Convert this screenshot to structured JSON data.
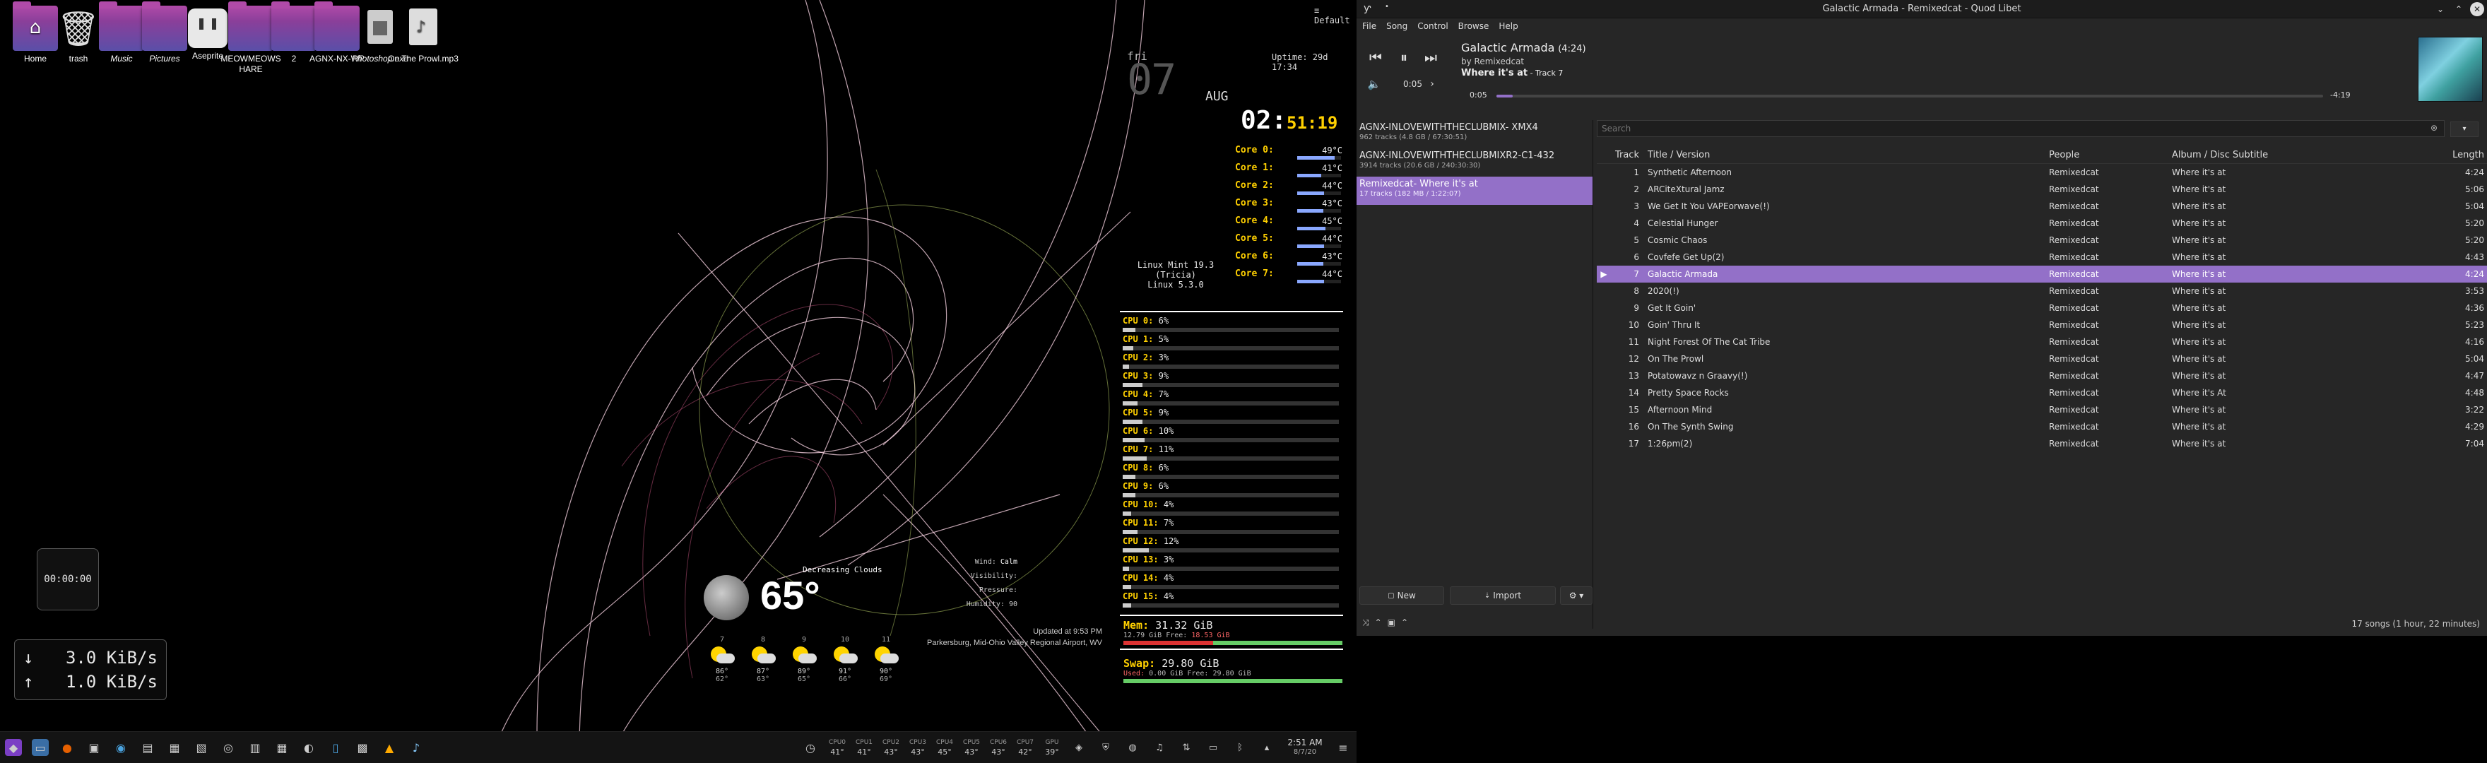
{
  "desktop": {
    "icons": [
      {
        "label": "Home",
        "italic": false,
        "kind": "home"
      },
      {
        "label": "trash",
        "italic": false,
        "kind": "trash"
      },
      {
        "label": "Music",
        "italic": true,
        "kind": "folder"
      },
      {
        "label": "Pictures",
        "italic": true,
        "kind": "folder"
      },
      {
        "label": "Aseprite",
        "italic": false,
        "kind": "app"
      },
      {
        "label": "MEOWMEOWS HARE",
        "italic": false,
        "kind": "folder"
      },
      {
        "label": "2",
        "italic": false,
        "kind": "folder"
      },
      {
        "label": "AGNX-NX-WP",
        "italic": false,
        "kind": "folder"
      },
      {
        "label": "Photoshop.exe",
        "italic": true,
        "kind": "exe"
      },
      {
        "label": "On The Prowl.mp3",
        "italic": false,
        "kind": "audio"
      }
    ],
    "default_label": "Default",
    "uptime": "Uptime: 29d 17:34",
    "date_prefix": "fri",
    "date_day": "07",
    "date_month": "AUG",
    "time_hm": "02:",
    "time_ms": "51:19",
    "os_line1": "Linux Mint 19.3 (Tricia)",
    "os_line2": "Linux 5.3.0",
    "timer": "00:00:00",
    "net_down": "3.0 KiB/s",
    "net_up": "1.0 KiB/s",
    "cores": [
      {
        "label": "Core 0:",
        "temp": "49°C",
        "level": 0.85
      },
      {
        "label": "Core 1:",
        "temp": "41°C",
        "level": 0.55
      },
      {
        "label": "Core 2:",
        "temp": "44°C",
        "level": 0.62
      },
      {
        "label": "Core 3:",
        "temp": "43°C",
        "level": 0.6
      },
      {
        "label": "Core 4:",
        "temp": "45°C",
        "level": 0.65
      },
      {
        "label": "Core 5:",
        "temp": "44°C",
        "level": 0.62
      },
      {
        "label": "Core 6:",
        "temp": "43°C",
        "level": 0.6
      },
      {
        "label": "Core 7:",
        "temp": "44°C",
        "level": 0.62
      }
    ],
    "cpus": [
      {
        "label": "CPU 0:",
        "pct": "6%",
        "level": 0.06
      },
      {
        "label": "CPU 1:",
        "pct": "5%",
        "level": 0.05
      },
      {
        "label": "CPU 2:",
        "pct": "3%",
        "level": 0.03
      },
      {
        "label": "CPU 3:",
        "pct": "9%",
        "level": 0.09
      },
      {
        "label": "CPU 4:",
        "pct": "7%",
        "level": 0.07
      },
      {
        "label": "CPU 5:",
        "pct": "9%",
        "level": 0.09
      },
      {
        "label": "CPU 6:",
        "pct": "10%",
        "level": 0.1
      },
      {
        "label": "CPU 7:",
        "pct": "11%",
        "level": 0.11
      },
      {
        "label": "CPU 8:",
        "pct": "6%",
        "level": 0.06
      },
      {
        "label": "CPU 9:",
        "pct": "6%",
        "level": 0.06
      },
      {
        "label": "CPU 10:",
        "pct": "4%",
        "level": 0.04
      },
      {
        "label": "CPU 11:",
        "pct": "7%",
        "level": 0.07
      },
      {
        "label": "CPU 12:",
        "pct": "12%",
        "level": 0.12
      },
      {
        "label": "CPU 13:",
        "pct": "3%",
        "level": 0.03
      },
      {
        "label": "CPU 14:",
        "pct": "4%",
        "level": 0.04
      },
      {
        "label": "CPU 15:",
        "pct": "4%",
        "level": 0.04
      }
    ],
    "mem_label": "Mem:",
    "mem_total": "31.32 GiB",
    "mem_used": "12.79 GiB",
    "mem_free_label": "Free:",
    "mem_free": "18.53 GiB",
    "mem_level": 0.41,
    "swap_label": "Swap:",
    "swap_total": "29.80 GiB",
    "swap_used": "0.00 GiB",
    "swap_free_label": "Free:",
    "swap_free": "29.80 GiB",
    "swap_used_label": "Used:",
    "swap_level": 0.0,
    "weather": {
      "condition": "Decreasing Clouds",
      "temp": "65°",
      "wind_label": "Wind:",
      "wind": "Calm",
      "visibility_label": "Visibility:",
      "pressure_label": "Pressure:",
      "humidity_label": "Humidity:",
      "humidity": "90",
      "updated": "Updated at 9:53 PM",
      "location": "Parkersburg, Mid-Ohio Valley Regional Airport, WV",
      "forecast": [
        {
          "day": "7",
          "hi": "86°",
          "lo": "62°"
        },
        {
          "day": "8",
          "hi": "87°",
          "lo": "63°"
        },
        {
          "day": "9",
          "hi": "89°",
          "lo": "65°"
        },
        {
          "day": "10",
          "hi": "91°",
          "lo": "66°"
        },
        {
          "day": "11",
          "hi": "90°",
          "lo": "69°"
        }
      ]
    }
  },
  "taskbar": {
    "temps": [
      {
        "label": "CPU0",
        "val": "41°"
      },
      {
        "label": "CPU1",
        "val": "41°"
      },
      {
        "label": "CPU2",
        "val": "43°"
      },
      {
        "label": "CPU3",
        "val": "43°"
      },
      {
        "label": "CPU4",
        "val": "45°"
      },
      {
        "label": "CPU5",
        "val": "43°"
      },
      {
        "label": "CPU6",
        "val": "43°"
      },
      {
        "label": "CPU7",
        "val": "42°"
      },
      {
        "label": "GPU",
        "val": "39°"
      }
    ],
    "clock_time": "2:51 AM",
    "clock_date": "8/7/20"
  },
  "quodlibet": {
    "window_title": "Galactic Armada - Remixedcat - Quod Libet",
    "menu": [
      "File",
      "Song",
      "Control",
      "Browse",
      "Help"
    ],
    "song_title": "Galactic Armada",
    "song_length": "(4:24)",
    "song_by": "by Remixedcat",
    "song_album": "Where it's at",
    "song_track": " - Track 7",
    "position": "0:05",
    "pos_short": "0:05",
    "remaining": "-4:19",
    "progress": 0.02,
    "search_placeholder": "Search",
    "albums": [
      {
        "name": "AGNX-INLOVEWITHTHECLUBMIX- XMX4",
        "meta": "962 tracks (4.8 GB / 67:30:51)",
        "selected": false
      },
      {
        "name": "AGNX-INLOVEWITHTHECLUBMIXR2-C1-432",
        "meta": "3914 tracks (20.6 GB / 240:30:30)",
        "selected": false
      },
      {
        "name": "Remixedcat- Where it's at",
        "meta": "17 tracks (182 MB / 1:22:07)",
        "selected": true
      }
    ],
    "columns": {
      "track": "Track",
      "title": "Title / Version",
      "people": "People",
      "album": "Album / Disc Subtitle",
      "length": "Length"
    },
    "tracks": [
      {
        "n": "1",
        "title": "Synthetic Afternoon",
        "people": "Remixedcat",
        "album": "Where it's at",
        "len": "4:24"
      },
      {
        "n": "2",
        "title": "ARCiteXtural Jamz",
        "people": "Remixedcat",
        "album": "Where it's at",
        "len": "5:06"
      },
      {
        "n": "3",
        "title": "We Get It You VAPEorwave(!)",
        "people": "Remixedcat",
        "album": "Where it's at",
        "len": "5:04"
      },
      {
        "n": "4",
        "title": "Celestial Hunger",
        "people": "Remixedcat",
        "album": "Where it's at",
        "len": "5:20"
      },
      {
        "n": "5",
        "title": "Cosmic Chaos",
        "people": "Remixedcat",
        "album": "Where it's at",
        "len": "5:20"
      },
      {
        "n": "6",
        "title": "Covfefe Get Up(2)",
        "people": "Remixedcat",
        "album": "Where it's at",
        "len": "4:43"
      },
      {
        "n": "7",
        "title": "Galactic Armada",
        "people": "Remixedcat",
        "album": "Where it's at",
        "len": "4:24",
        "current": true
      },
      {
        "n": "8",
        "title": "2020(!)",
        "people": "Remixedcat",
        "album": "Where it's at",
        "len": "3:53"
      },
      {
        "n": "9",
        "title": "Get It Goin'",
        "people": "Remixedcat",
        "album": "Where it's at",
        "len": "4:36"
      },
      {
        "n": "10",
        "title": "Goin' Thru It",
        "people": "Remixedcat",
        "album": "Where it's at",
        "len": "5:23"
      },
      {
        "n": "11",
        "title": "Night Forest Of The Cat Tribe",
        "people": "Remixedcat",
        "album": "Where it's at",
        "len": "4:16"
      },
      {
        "n": "12",
        "title": "On The Prowl",
        "people": "Remixedcat",
        "album": "Where it's at",
        "len": "5:04"
      },
      {
        "n": "13",
        "title": "Potatowavz n Graavy(!)",
        "people": "Remixedcat",
        "album": "Where it's at",
        "len": "4:47"
      },
      {
        "n": "14",
        "title": "Pretty Space Rocks",
        "people": "Remixedcat",
        "album": "Where it's At",
        "len": "4:48"
      },
      {
        "n": "15",
        "title": "Afternoon Mind",
        "people": "Remixedcat",
        "album": "Where it's at",
        "len": "3:22"
      },
      {
        "n": "16",
        "title": "On The Synth Swing",
        "people": "Remixedcat",
        "album": "Where it's at",
        "len": "4:29"
      },
      {
        "n": "17",
        "title": "1:26pm(2)",
        "people": "Remixedcat",
        "album": "Where it's at",
        "len": "7:04"
      }
    ],
    "btn_new": "New",
    "btn_import": "Import",
    "status": "17 songs (1 hour, 22 minutes)"
  }
}
